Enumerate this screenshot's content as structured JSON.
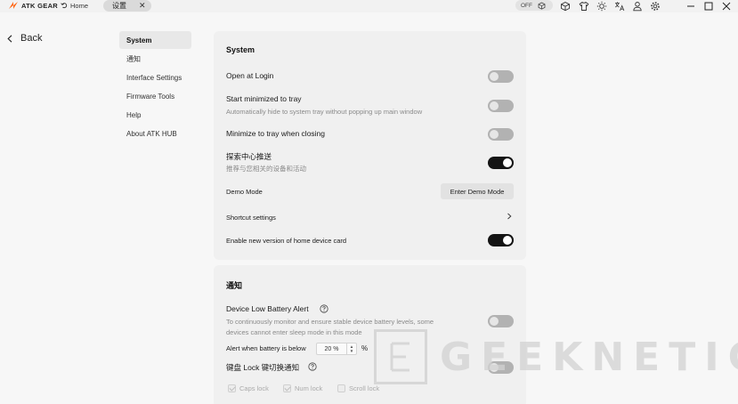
{
  "titlebar": {
    "brand": "ATK GEAR",
    "home_label": "Home",
    "tab_label": "设置",
    "off_label": "OFF",
    "icons": [
      "cube-icon",
      "shirt-icon",
      "brightness-icon",
      "translate-icon",
      "user-icon",
      "settings-icon",
      "minimize-icon",
      "maximize-icon",
      "close-icon"
    ],
    "accent": "#ff6a1a"
  },
  "back": {
    "label": "Back"
  },
  "nav": {
    "items": [
      {
        "label": "System",
        "active": true
      },
      {
        "label": "通知",
        "active": false
      },
      {
        "label": "Interface Settings",
        "active": false
      },
      {
        "label": "Firmware Tools",
        "active": false
      },
      {
        "label": "Help",
        "active": false
      },
      {
        "label": "About ATK HUB",
        "active": false
      }
    ]
  },
  "system": {
    "title": "System",
    "open_login": {
      "label": "Open at Login",
      "enabled": false
    },
    "start_minimized": {
      "label": "Start minimized to tray",
      "desc": "Automatically hide to system tray without popping up main window",
      "enabled": false
    },
    "minimize_close": {
      "label": "Minimize to tray when closing",
      "enabled": false
    },
    "discovery_push": {
      "label": "探索中心推送",
      "desc": "推荐与您相关的设备和活动",
      "enabled": true
    },
    "demo_mode": {
      "label": "Demo Mode",
      "button": "Enter Demo Mode"
    },
    "shortcut": {
      "label": "Shortcut settings"
    },
    "new_card": {
      "label": "Enable new version of home device card",
      "enabled": true
    }
  },
  "notify": {
    "title": "通知",
    "low_battery": {
      "label": "Device Low Battery Alert",
      "desc_line1": "To continuously monitor and ensure stable device battery levels, some",
      "desc_line2": "devices cannot enter sleep mode in this mode",
      "enabled": false,
      "threshold_label": "Alert when battery is below",
      "threshold_value": "20 %",
      "unit": "%"
    },
    "lock_key": {
      "label": "键盘 Lock 键切换通知",
      "enabled": false,
      "options": [
        {
          "label": "Caps lock",
          "checked": true
        },
        {
          "label": "Num lock",
          "checked": true
        },
        {
          "label": "Scroll lock",
          "checked": false
        }
      ]
    }
  },
  "watermark": {
    "text": "GEEKNETIC"
  }
}
